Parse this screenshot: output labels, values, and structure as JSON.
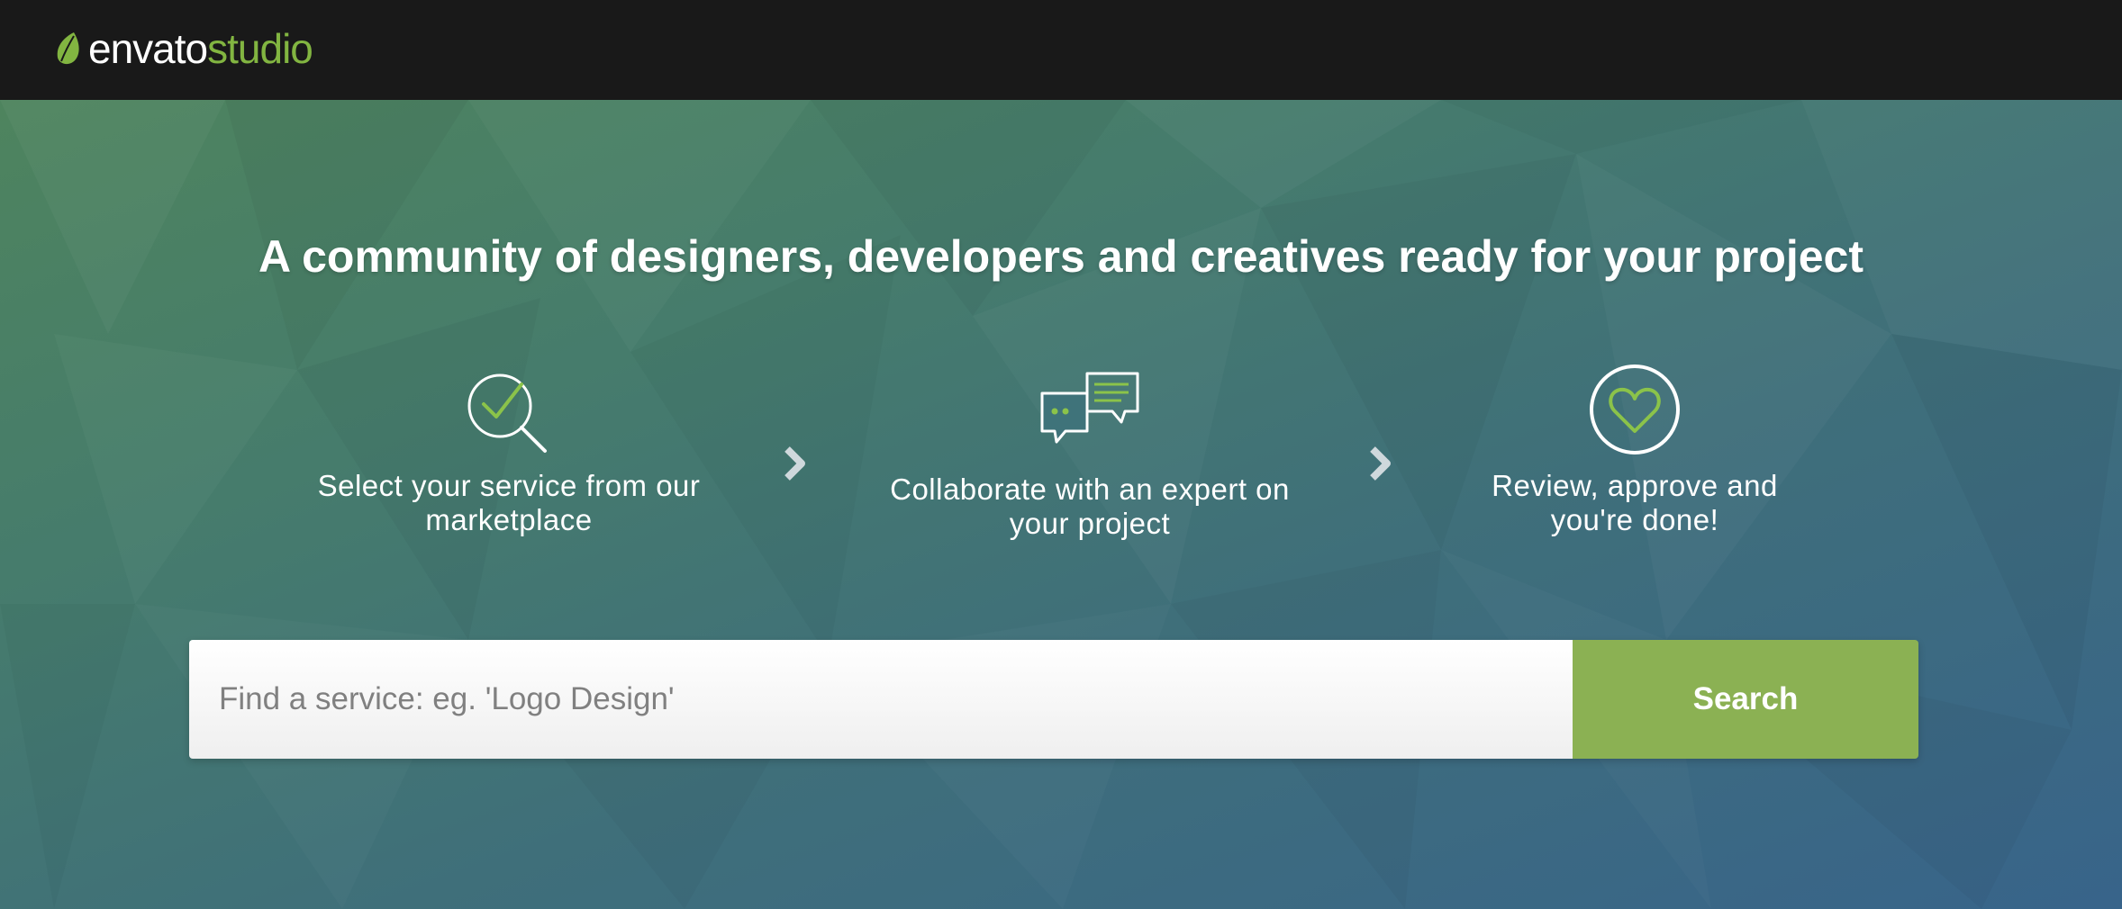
{
  "header": {
    "logo_primary": "envato",
    "logo_secondary": "studio"
  },
  "hero": {
    "headline": "A community of designers, developers and creatives ready for your project",
    "steps": [
      {
        "icon": "search-check-icon",
        "text": "Select your service from our\nmarketplace"
      },
      {
        "icon": "chat-bubbles-icon",
        "text": "Collaborate with an expert on\nyour project"
      },
      {
        "icon": "heart-circle-icon",
        "text": "Review, approve and\nyou're done!"
      }
    ]
  },
  "search": {
    "placeholder": "Find a service: eg. 'Logo Design'",
    "value": "",
    "button_label": "Search"
  },
  "colors": {
    "brand_green": "#82b541",
    "button_green": "#8bb153",
    "topbar": "#191919",
    "icon_accent": "#8bc34a"
  }
}
